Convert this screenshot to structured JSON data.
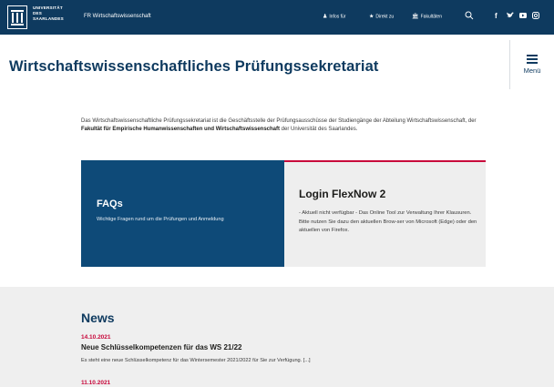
{
  "topbar": {
    "university_name_lines": [
      "UNIVERSITÄT",
      "DES",
      "SAARLANDES"
    ],
    "fr_link": "FR Wirtschaftswissenschaft",
    "nav": [
      {
        "icon": "user-icon",
        "glyph": "♟",
        "label": "Infos für"
      },
      {
        "icon": "star-icon",
        "glyph": "★",
        "label": "Direkt zu"
      },
      {
        "icon": "building-icon",
        "glyph": "🏛",
        "label": "Fakultäten"
      }
    ],
    "search_icon": "search-icon",
    "social_icons": [
      "facebook-icon",
      "twitter-icon",
      "youtube-icon",
      "instagram-icon"
    ],
    "colors": {
      "bar": "#0e3a5f"
    }
  },
  "header": {
    "title": "Wirtschaftswissenschaftliches Prüfungssekretariat",
    "menu_label": "Menü"
  },
  "intro": {
    "text_before": "Das Wirtschaftswissenschaftliche Prüfungssekretariat ist die Geschäftsstelle der Prüfungsausschüsse der Studiengänge der Abteilung Wirtschaftswissenschaft, der ",
    "bold": "Fakultät für Empirische Humanwissenschaften und Wirtschaftswissenschaft",
    "text_after": " der Universität des Saarlandes."
  },
  "cards": {
    "faq": {
      "title": "FAQs",
      "subtitle": "Wichtige Fragen rund um die Prüfungen und Anmeldung"
    },
    "login": {
      "title": "Login FlexNow 2",
      "description": "- Aktuell nicht verfügbar - Das Online Tool zur Verwaltung Ihrer Klausuren. Bitte nutzen Sie dazu den aktuellen Brow-ser von Microsoft (Edge) oder den aktuellen von Firefox."
    },
    "colors": {
      "faq_bg": "#0e4a78",
      "login_bg": "#eeeeee",
      "accent": "#c8083b"
    }
  },
  "news": {
    "heading": "News",
    "items": [
      {
        "date": "14.10.2021",
        "title": "Neue Schlüsselkompetenzen für das WS 21/22",
        "teaser": "Es steht eine neue Schlüsselkompetenz für das Wintersemester 2021/2022 für Sie zur Verfügung. [...]"
      },
      {
        "date": "11.10.2021"
      }
    ]
  }
}
